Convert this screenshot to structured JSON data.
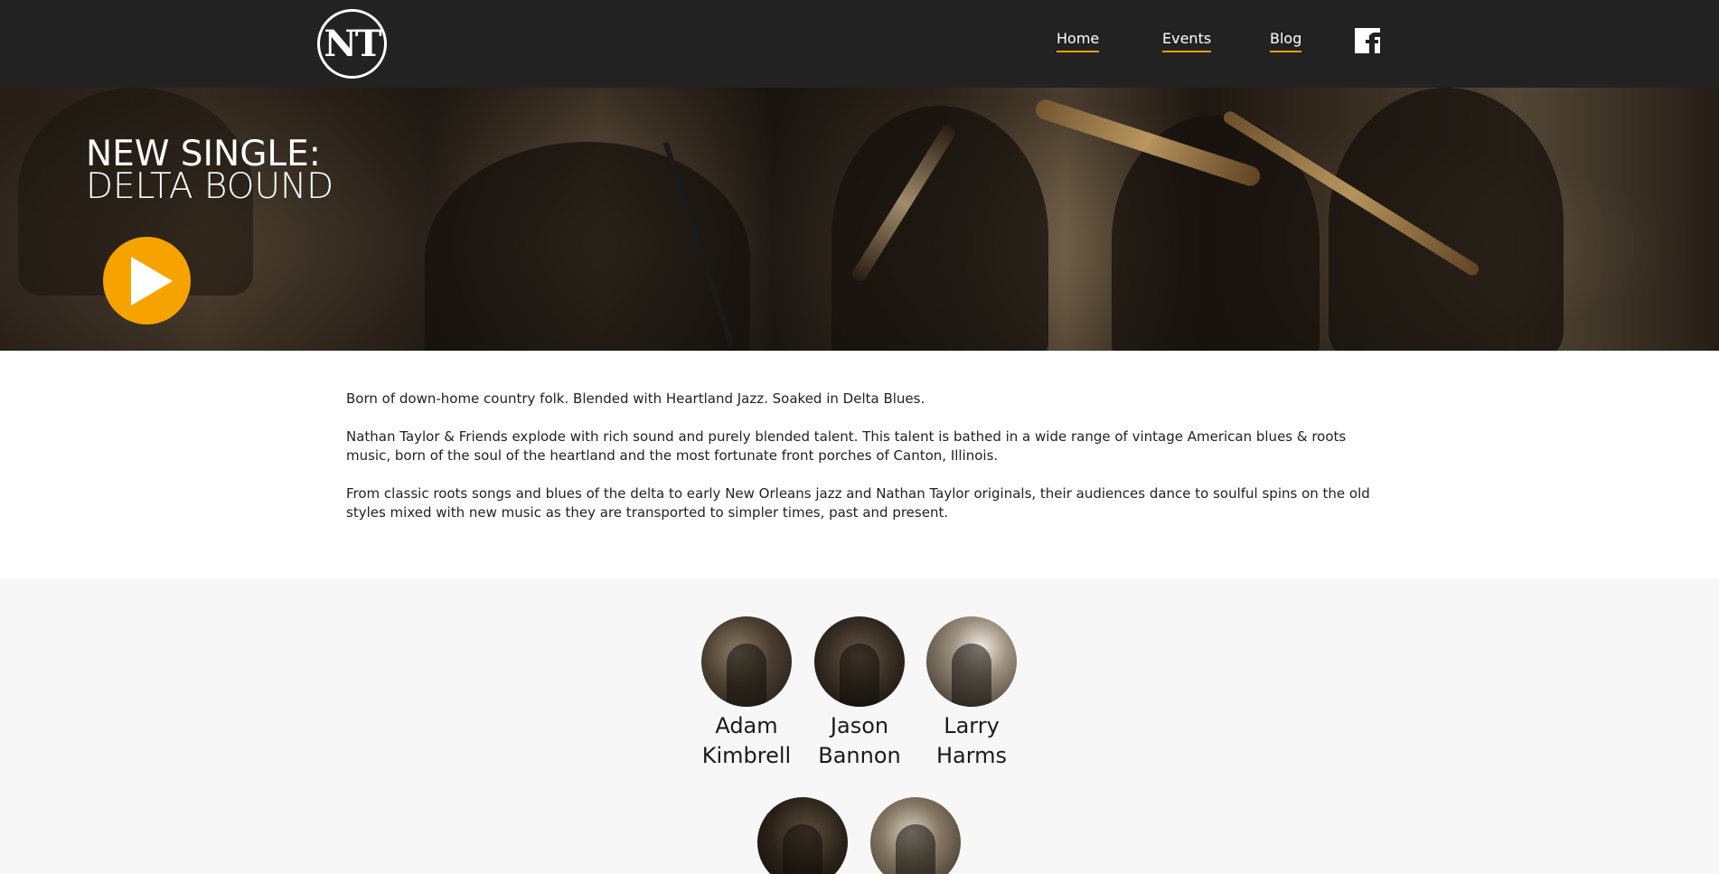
{
  "header": {
    "logo_text": "NT",
    "nav": [
      {
        "label": "Home"
      },
      {
        "label": "Events"
      },
      {
        "label": "Blog"
      }
    ],
    "social_icon": "facebook-icon",
    "accent_color": "#e8a000"
  },
  "hero": {
    "title_line1": "NEW SINGLE:",
    "title_line2": "DELTA BOUND",
    "play_icon": "play-icon",
    "play_color": "#f6a300"
  },
  "intro": {
    "paragraphs": [
      "Born of down-home country folk. Blended with Heartland Jazz. Soaked in Delta Blues.",
      "Nathan Taylor & Friends explode with rich sound and purely blended talent. This talent is bathed in a wide range of vintage American blues & roots music, born of the soul of the heartland and the most fortunate front porches of Canton, Illinois.",
      "From classic roots songs and blues of the delta to early New Orleans jazz and Nathan Taylor originals, their audiences dance to soulful spins on the old styles mixed with new music as they are transported to simpler times, past and present."
    ]
  },
  "members": [
    {
      "first": "Adam",
      "last": "Kimbrell"
    },
    {
      "first": "Jason",
      "last": "Bannon"
    },
    {
      "first": "Larry",
      "last": "Harms"
    },
    {
      "first": "",
      "last": ""
    },
    {
      "first": "",
      "last": ""
    }
  ]
}
